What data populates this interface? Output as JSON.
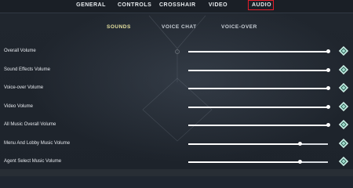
{
  "nav": {
    "tabs": [
      {
        "label": "GENERAL"
      },
      {
        "label": "CONTROLS"
      },
      {
        "label": "CROSSHAIR"
      },
      {
        "label": "VIDEO"
      },
      {
        "label": "AUDIO"
      }
    ],
    "active": "AUDIO",
    "active_outline_color": "#e11d2a"
  },
  "subtabs": {
    "items": [
      {
        "label": "SOUNDS"
      },
      {
        "label": "VOICE CHAT"
      },
      {
        "label": "VOICE-OVER"
      }
    ],
    "active": "SOUNDS",
    "active_color": "#e6e1a0"
  },
  "settings": {
    "rows": [
      {
        "label": "Overall Volume",
        "value_fraction": 1.0
      },
      {
        "label": "Sound Effects Volume",
        "value_fraction": 1.0
      },
      {
        "label": "Voice-over Volume",
        "value_fraction": 1.0
      },
      {
        "label": "Video Volume",
        "value_fraction": 1.0
      },
      {
        "label": "All Music Overall Volume",
        "value_fraction": 1.0
      },
      {
        "label": "Menu And Lobby Music Volume",
        "value_fraction": 0.8
      },
      {
        "label": "Agent Select Music Volume",
        "value_fraction": 0.8
      }
    ],
    "reset_icon": "diamond-reset-icon"
  }
}
